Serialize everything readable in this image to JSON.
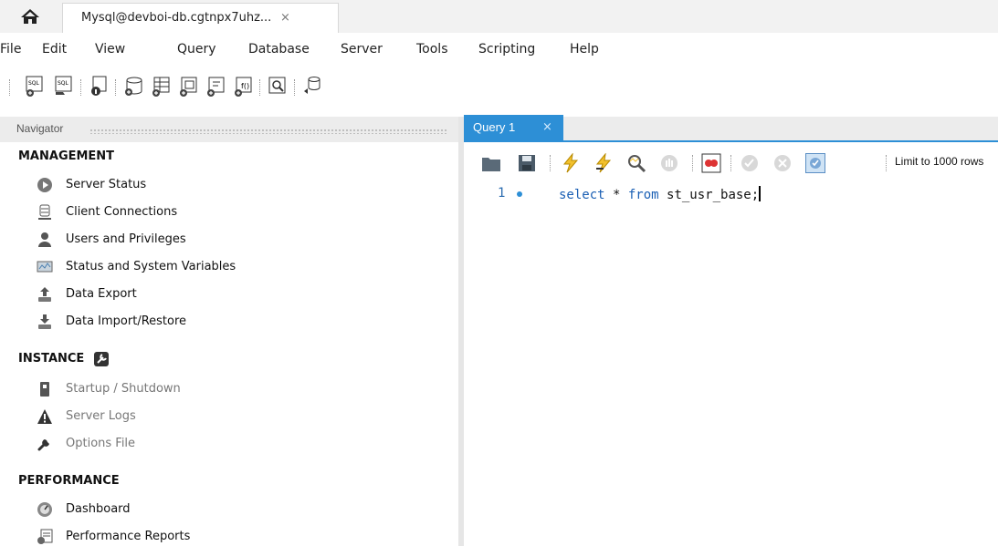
{
  "connection_tab": {
    "label": "Mysql@devboi-db.cgtnpx7uhz...",
    "close": "×"
  },
  "menu": [
    "File",
    "Edit",
    "View",
    "Query",
    "Database",
    "Server",
    "Tools",
    "Scripting",
    "Help"
  ],
  "toolbar": {
    "icons": [
      "new-sql-tab-icon",
      "open-sql-script-icon",
      "inspector-icon",
      "create-schema-icon",
      "create-table-icon",
      "create-view-icon",
      "create-procedure-icon",
      "create-function-icon",
      "search-table-data-icon",
      "reconnect-icon"
    ]
  },
  "navigator": {
    "title": "Navigator",
    "management": {
      "heading": "MANAGEMENT",
      "items": [
        "Server Status",
        "Client Connections",
        "Users and Privileges",
        "Status and System Variables",
        "Data Export",
        "Data Import/Restore"
      ]
    },
    "instance": {
      "heading": "INSTANCE",
      "items": [
        "Startup / Shutdown",
        "Server Logs",
        "Options File"
      ]
    },
    "performance": {
      "heading": "PERFORMANCE",
      "items": [
        "Dashboard",
        "Performance Reports"
      ]
    }
  },
  "query_tab": {
    "label": "Query 1",
    "close": "×"
  },
  "sql_toolbar": {
    "limit_label": "Limit to 1000 rows"
  },
  "editor": {
    "line_number": "1",
    "code": {
      "kw1": "select",
      "star": " * ",
      "kw2": "from",
      "table": " st_usr_base;"
    }
  },
  "colors": {
    "accent": "#2d8fd6",
    "keyword": "#1a5fb4"
  }
}
